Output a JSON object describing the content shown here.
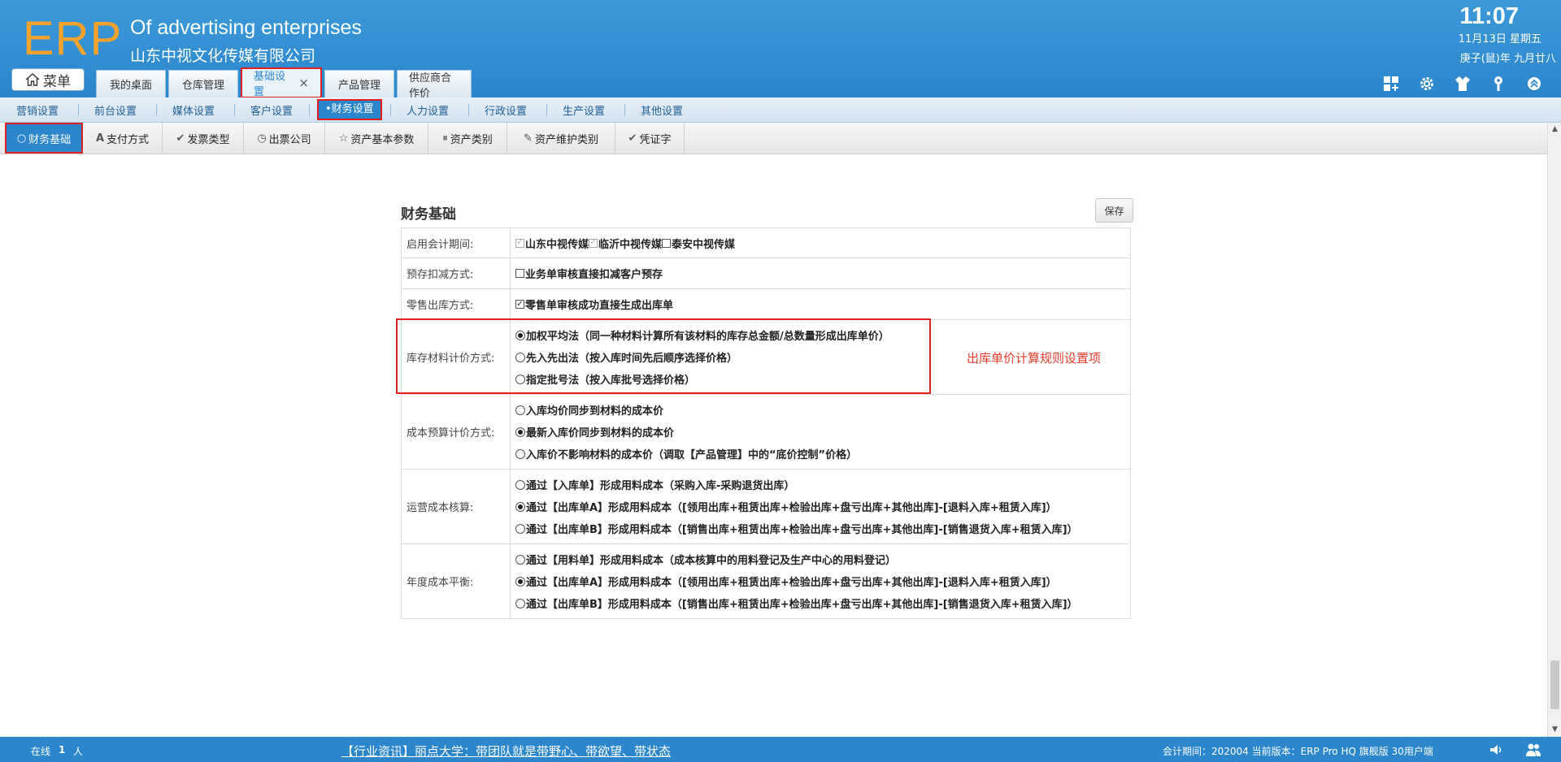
{
  "header": {
    "logo": "ERP",
    "subtitle_en": "Of advertising enterprises",
    "company": "山东中视文化传媒有限公司",
    "time": "11:07",
    "date": "11月13日 星期五",
    "lunar": "庚子(鼠)年 九月廿八",
    "menu_label": "菜单",
    "tabs": [
      {
        "label": "我的桌面"
      },
      {
        "label": "仓库管理"
      },
      {
        "label": "基础设置",
        "close": "×"
      },
      {
        "label": "产品管理"
      },
      {
        "label": "供应商合作价"
      }
    ],
    "icons": [
      "grid-add-icon",
      "gear-icon",
      "shirt-icon",
      "key-icon",
      "chevron-up-icon"
    ]
  },
  "subnav": {
    "items": [
      "营销设置",
      "前台设置",
      "媒体设置",
      "客户设置",
      "•财务设置",
      "人力设置",
      "行政设置",
      "生产设置",
      "其他设置"
    ]
  },
  "toolbar": {
    "items": [
      {
        "label": "财务基础",
        "icon": "circle-icon"
      },
      {
        "label": "支付方式",
        "icon": "letter-a-icon"
      },
      {
        "label": "发票类型",
        "icon": "check-icon"
      },
      {
        "label": "出票公司",
        "icon": "clock-icon"
      },
      {
        "label": "资产基本参数",
        "icon": "star-icon"
      },
      {
        "label": "资产类别",
        "icon": "pause-icon"
      },
      {
        "label": "资产维护类别",
        "icon": "pencil-icon"
      },
      {
        "label": "凭证字",
        "icon": "check-icon"
      }
    ]
  },
  "panel": {
    "title": "财务基础",
    "save_label": "保存",
    "annotation": "出库单价计算规则设置项",
    "rows": [
      {
        "label": "启用会计期间:",
        "inline": true,
        "options": [
          {
            "type": "checkbox",
            "checked": true,
            "disabled": true,
            "text": "山东中视传媒"
          },
          {
            "type": "checkbox",
            "checked": true,
            "disabled": true,
            "text": "临沂中视传媒"
          },
          {
            "type": "checkbox",
            "checked": false,
            "text": "泰安中视传媒"
          }
        ]
      },
      {
        "label": "预存扣减方式:",
        "options": [
          {
            "type": "checkbox",
            "checked": false,
            "text": "业务单审核直接扣减客户预存"
          }
        ]
      },
      {
        "label": "零售出库方式:",
        "options": [
          {
            "type": "checkbox",
            "checked": true,
            "text": "零售单审核成功直接生成出库单"
          }
        ]
      },
      {
        "label": "库存材料计价方式:",
        "options": [
          {
            "type": "radio",
            "checked": true,
            "text": "加权平均法（同一种材料计算所有该材料的库存总金额/总数量形成出库单价）"
          },
          {
            "type": "radio",
            "checked": false,
            "text": "先入先出法（按入库时间先后顺序选择价格）"
          },
          {
            "type": "radio",
            "checked": false,
            "text": "指定批号法（按入库批号选择价格）"
          }
        ]
      },
      {
        "label": "成本预算计价方式:",
        "options": [
          {
            "type": "radio",
            "checked": false,
            "text": "入库均价同步到材料的成本价"
          },
          {
            "type": "radio",
            "checked": true,
            "text": "最新入库价同步到材料的成本价"
          },
          {
            "type": "radio",
            "checked": false,
            "text": "入库价不影响材料的成本价（调取【产品管理】中的“底价控制”价格）"
          }
        ]
      },
      {
        "label": "运营成本核算:",
        "options": [
          {
            "type": "radio",
            "checked": false,
            "text": "通过【入库单】形成用料成本（采购入库-采购退货出库）"
          },
          {
            "type": "radio",
            "checked": true,
            "text": "通过【出库单A】形成用料成本（[领用出库+租赁出库+检验出库+盘亏出库+其他出库]-[退料入库+租赁入库]）"
          },
          {
            "type": "radio",
            "checked": false,
            "text": "通过【出库单B】形成用料成本（[销售出库+租赁出库+检验出库+盘亏出库+其他出库]-[销售退货入库+租赁入库]）"
          }
        ]
      },
      {
        "label": "年度成本平衡:",
        "options": [
          {
            "type": "radio",
            "checked": false,
            "text": "通过【用料单】形成用料成本（成本核算中的用料登记及生产中心的用料登记）"
          },
          {
            "type": "radio",
            "checked": true,
            "text": "通过【出库单A】形成用料成本（[领用出库+租赁出库+检验出库+盘亏出库+其他出库]-[退料入库+租赁入库]）"
          },
          {
            "type": "radio",
            "checked": false,
            "text": "通过【出库单B】形成用料成本（[销售出库+租赁出库+检验出库+盘亏出库+其他出库]-[销售退货入库+租赁入库]）"
          }
        ]
      }
    ]
  },
  "footer": {
    "online_label": "在线",
    "online_count": "1",
    "online_unit": "人",
    "news": "【行业资讯】丽点大学：带团队就是带野心、带欲望、带状态",
    "period_version": "会计期间：202004 当前版本：ERP Pro HQ 旗舰版 30用户端"
  }
}
